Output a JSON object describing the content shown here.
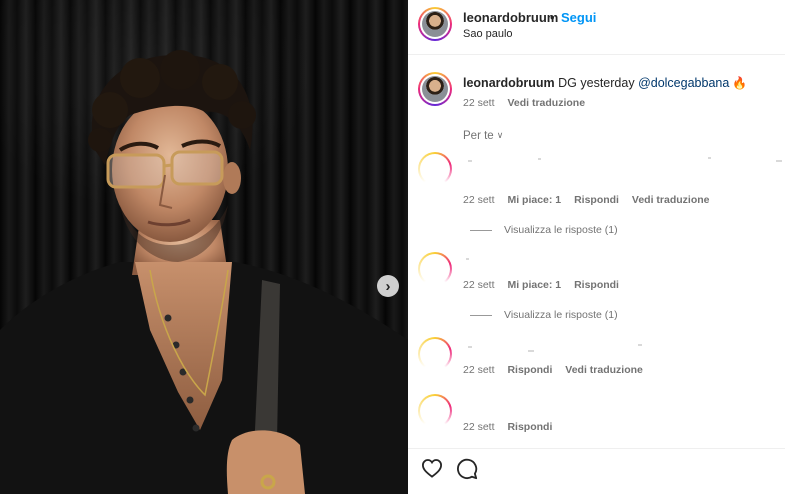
{
  "header": {
    "username": "leonardobruum",
    "separator": "•",
    "follow_label": "Segui",
    "location": "Sao paulo"
  },
  "caption": {
    "username": "leonardobruum",
    "text": "DG yesterday",
    "mention": "@dolcegabbana",
    "emoji": "🔥",
    "date": "22 sett",
    "translate_label": "Vedi traduzione"
  },
  "sort": {
    "label": "Per te",
    "chevron": "chevron-down-icon"
  },
  "comments": [
    {
      "date": "22 sett",
      "likes_label": "Mi piace: 1",
      "reply_label": "Rispondi",
      "translate_label": "Vedi traduzione",
      "view_replies": "Visualizza le risposte (1)"
    },
    {
      "date": "22 sett",
      "likes_label": "Mi piace: 1",
      "reply_label": "Rispondi",
      "view_replies": "Visualizza le risposte (1)"
    },
    {
      "date": "22 sett",
      "reply_label": "Rispondi",
      "translate_label": "Vedi traduzione"
    },
    {
      "date": "22 sett",
      "reply_label": "Rispondi"
    }
  ],
  "carousel": {
    "next_icon": "chevron-right-icon",
    "next_glyph": "›"
  },
  "icons": {
    "like": "heart-icon",
    "comment": "comment-icon"
  },
  "colors": {
    "follow": "#0095f6",
    "mention": "#00376b",
    "muted": "#737373"
  }
}
